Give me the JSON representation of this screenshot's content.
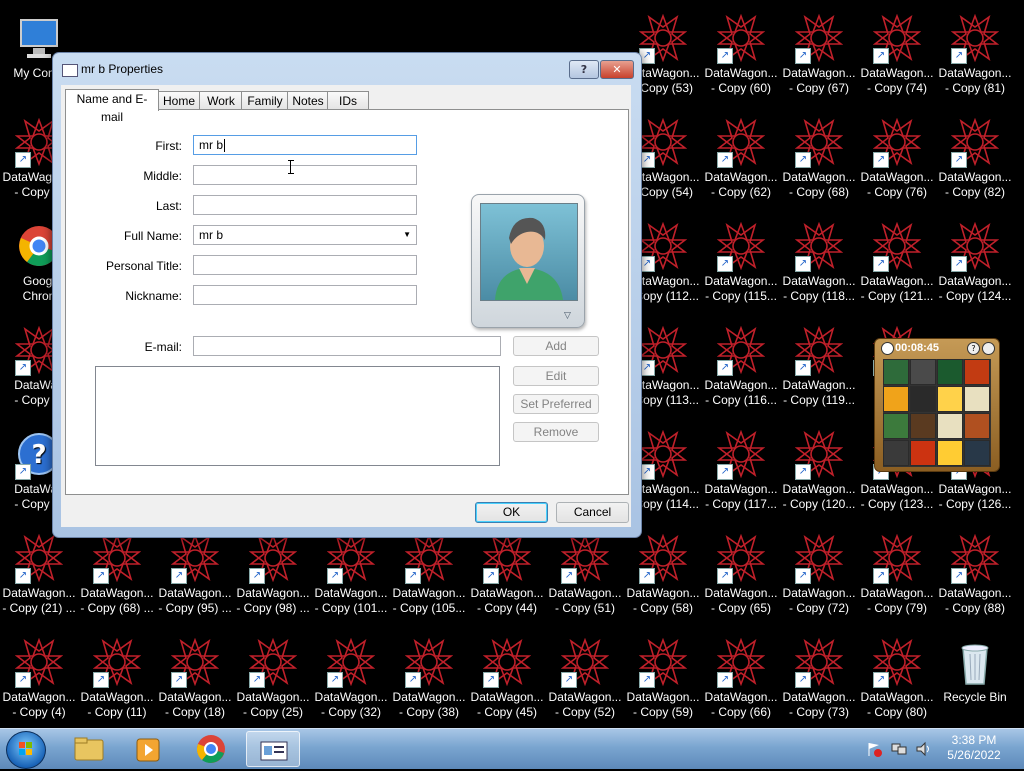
{
  "desktop": {
    "icons": [
      {
        "label1": "My Comp",
        "label2": "",
        "kind": "computer",
        "shortcut": false
      },
      {
        "label1": "DataWagon...",
        "label2": "- Copy (7",
        "kind": "star",
        "shortcut": true
      },
      {
        "label1": "Googl",
        "label2": "Chron",
        "kind": "chrome",
        "shortcut": false
      },
      {
        "label1": "DataWag",
        "label2": "- Copy (1",
        "kind": "star",
        "shortcut": true
      },
      {
        "label1": "DataWag",
        "label2": "- Copy (6",
        "kind": "help",
        "shortcut": true
      },
      {
        "label1": "DataWagon...",
        "label2": "- Copy (21) ...",
        "kind": "star",
        "shortcut": true
      },
      {
        "label1": "DataWagon...",
        "label2": "- Copy (4)",
        "kind": "star",
        "shortcut": true
      },
      {
        "label1": "DataWagon...",
        "label2": "- Copy (68) ...",
        "kind": "star",
        "shortcut": true
      },
      {
        "label1": "DataWagon...",
        "label2": "- Copy (11)",
        "kind": "star",
        "shortcut": true
      },
      {
        "label1": "DataWagon...",
        "label2": "- Copy (95) ...",
        "kind": "star",
        "shortcut": true
      },
      {
        "label1": "DataWagon...",
        "label2": "- Copy (18)",
        "kind": "star",
        "shortcut": true
      },
      {
        "label1": "DataWagon...",
        "label2": "- Copy (98) ...",
        "kind": "star",
        "shortcut": true
      },
      {
        "label1": "DataWagon...",
        "label2": "- Copy (25)",
        "kind": "star",
        "shortcut": true
      },
      {
        "label1": "DataWagon...",
        "label2": "- Copy (101...",
        "kind": "star",
        "shortcut": true
      },
      {
        "label1": "DataWagon...",
        "label2": "- Copy (32)",
        "kind": "star",
        "shortcut": true
      },
      {
        "label1": "DataWagon...",
        "label2": "- Copy (105...",
        "kind": "star",
        "shortcut": true
      },
      {
        "label1": "DataWagon...",
        "label2": "- Copy (38)",
        "kind": "star",
        "shortcut": true
      },
      {
        "label1": "DataWagon...",
        "label2": "- Copy (44)",
        "kind": "star",
        "shortcut": true
      },
      {
        "label1": "DataWagon...",
        "label2": "- Copy (45)",
        "kind": "star",
        "shortcut": true
      },
      {
        "label1": "DataWagon...",
        "label2": "- Copy (51)",
        "kind": "star",
        "shortcut": true
      },
      {
        "label1": "DataWagon...",
        "label2": "- Copy (52)",
        "kind": "star",
        "shortcut": true
      },
      {
        "label1": "DataWagon...",
        "label2": "- Copy (53)",
        "kind": "star",
        "shortcut": true
      },
      {
        "label1": "DataWagon...",
        "label2": "- Copy (54)",
        "kind": "star",
        "shortcut": true
      },
      {
        "label1": "DataWagon...",
        "label2": "- Copy (112...",
        "kind": "star",
        "shortcut": true
      },
      {
        "label1": "DataWagon...",
        "label2": "- Copy (113...",
        "kind": "star",
        "shortcut": true
      },
      {
        "label1": "DataWagon...",
        "label2": "- Copy (114...",
        "kind": "star",
        "shortcut": true
      },
      {
        "label1": "DataWagon...",
        "label2": "- Copy (58)",
        "kind": "star",
        "shortcut": true
      },
      {
        "label1": "DataWagon...",
        "label2": "- Copy (59)",
        "kind": "star",
        "shortcut": true
      },
      {
        "label1": "DataWagon...",
        "label2": "- Copy (60)",
        "kind": "star",
        "shortcut": true
      },
      {
        "label1": "DataWagon...",
        "label2": "- Copy (62)",
        "kind": "star",
        "shortcut": true
      },
      {
        "label1": "DataWagon...",
        "label2": "- Copy (115...",
        "kind": "star",
        "shortcut": true
      },
      {
        "label1": "DataWagon...",
        "label2": "- Copy (116...",
        "kind": "star",
        "shortcut": true
      },
      {
        "label1": "DataWagon...",
        "label2": "- Copy (117...",
        "kind": "star",
        "shortcut": true
      },
      {
        "label1": "DataWagon...",
        "label2": "- Copy (65)",
        "kind": "star",
        "shortcut": true
      },
      {
        "label1": "DataWagon...",
        "label2": "- Copy (66)",
        "kind": "star",
        "shortcut": true
      },
      {
        "label1": "DataWagon...",
        "label2": "- Copy (67)",
        "kind": "star",
        "shortcut": true
      },
      {
        "label1": "DataWagon...",
        "label2": "- Copy (68)",
        "kind": "star",
        "shortcut": true
      },
      {
        "label1": "DataWagon...",
        "label2": "- Copy (118...",
        "kind": "star",
        "shortcut": true
      },
      {
        "label1": "DataWagon...",
        "label2": "- Copy (119...",
        "kind": "star",
        "shortcut": true
      },
      {
        "label1": "DataWagon...",
        "label2": "- Copy (120...",
        "kind": "star",
        "shortcut": true
      },
      {
        "label1": "DataWagon...",
        "label2": "- Copy (72)",
        "kind": "star",
        "shortcut": true
      },
      {
        "label1": "DataWagon...",
        "label2": "- Copy (73)",
        "kind": "star",
        "shortcut": true
      },
      {
        "label1": "DataWagon...",
        "label2": "- Copy (74)",
        "kind": "star",
        "shortcut": true
      },
      {
        "label1": "DataWagon...",
        "label2": "- Copy (76)",
        "kind": "star",
        "shortcut": true
      },
      {
        "label1": "DataWagon...",
        "label2": "- Copy (121...",
        "kind": "star",
        "shortcut": true
      },
      {
        "label1": "Da",
        "label2": "- C",
        "kind": "star",
        "shortcut": true
      },
      {
        "label1": "DataWagon...",
        "label2": "- Copy (123...",
        "kind": "star",
        "shortcut": true
      },
      {
        "label1": "DataWagon...",
        "label2": "- Copy (79)",
        "kind": "star",
        "shortcut": true
      },
      {
        "label1": "DataWagon...",
        "label2": "- Copy (80)",
        "kind": "star",
        "shortcut": true
      },
      {
        "label1": "DataWagon...",
        "label2": "- Copy (81)",
        "kind": "star",
        "shortcut": true
      },
      {
        "label1": "DataWagon...",
        "label2": "- Copy (82)",
        "kind": "star",
        "shortcut": true
      },
      {
        "label1": "DataWagon...",
        "label2": "- Copy (124...",
        "kind": "star",
        "shortcut": true
      },
      {
        "label1": "DataWagon...",
        "label2": "- Copy (126...",
        "kind": "star",
        "shortcut": true
      },
      {
        "label1": "DataWagon...",
        "label2": "- Copy (88)",
        "kind": "star",
        "shortcut": true
      },
      {
        "label1": "Recycle Bin",
        "label2": "",
        "kind": "recycle",
        "shortcut": false
      }
    ]
  },
  "dialog": {
    "title": "mr b Properties",
    "help_btn": "?",
    "close_btn": "✕",
    "tabs": [
      "Name and E-mail",
      "Home",
      "Work",
      "Family",
      "Notes",
      "IDs"
    ],
    "labels": {
      "first": "First:",
      "middle": "Middle:",
      "last": "Last:",
      "full_name": "Full Name:",
      "personal_title": "Personal Title:",
      "nickname": "Nickname:",
      "email": "E-mail:"
    },
    "values": {
      "first": "mr b",
      "middle": "",
      "last": "",
      "full_name": "mr b",
      "personal_title": "",
      "nickname": "",
      "email": ""
    },
    "buttons": {
      "add": "Add",
      "edit": "Edit",
      "set_preferred": "Set Preferred",
      "remove": "Remove",
      "ok": "OK",
      "cancel": "Cancel"
    }
  },
  "gadget": {
    "time": "00:08:45"
  },
  "taskbar": {
    "time": "3:38 PM",
    "date": "5/26/2022"
  }
}
